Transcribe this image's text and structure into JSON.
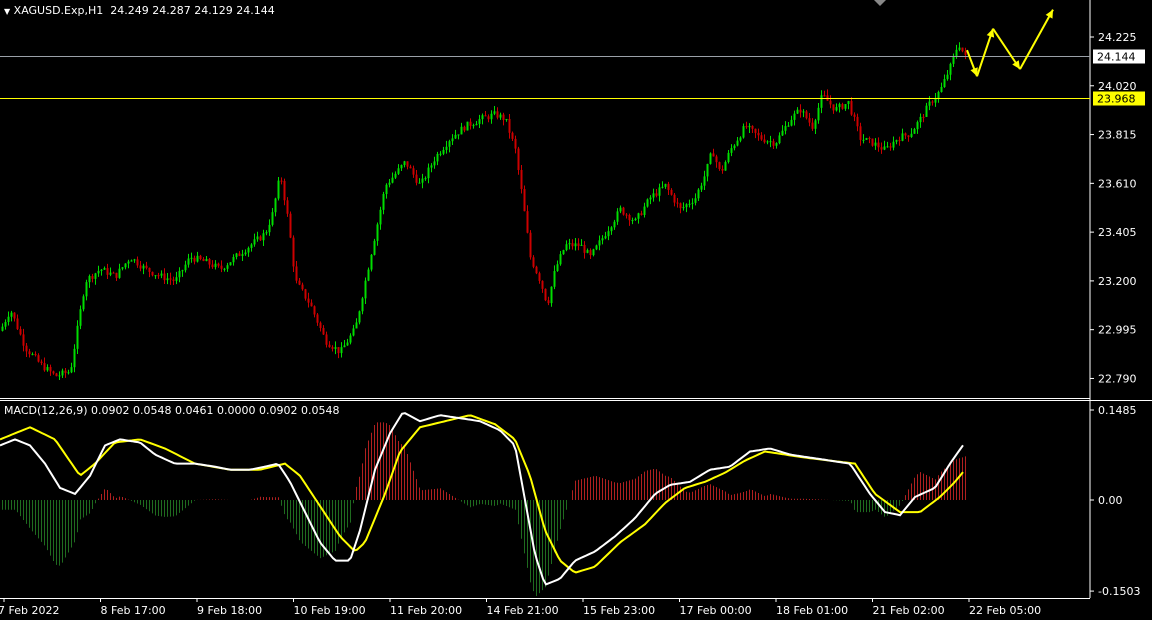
{
  "header": {
    "symbol": "XAGUSD.Exp,H1",
    "ohlc": "24.249 24.287 24.129 24.144",
    "macd_label": "MACD(12,26,9) 0.0902 0.0548 0.0461 0.0000 0.0902 0.0548"
  },
  "colors": {
    "background": "#000000",
    "grid": "#ffffff",
    "bull": "#00dd00",
    "bear": "#cc0000",
    "level": "#ffff00",
    "macd_line": "#ffffff",
    "signal_line": "#ffff00",
    "arrow": "#ffff00"
  },
  "chart_data": [
    {
      "type": "candlestick",
      "symbol": "XAGUSD.Exp",
      "timeframe": "H1",
      "y_ticks": [
        "24.225",
        "24.020",
        "23.815",
        "23.610",
        "23.405",
        "23.200",
        "22.995",
        "22.790"
      ],
      "ylim": [
        22.73,
        24.35
      ],
      "price_lines": [
        {
          "value": 24.144,
          "label": "24.144",
          "kind": "current"
        },
        {
          "value": 23.968,
          "label": "23.968",
          "kind": "level"
        }
      ],
      "x_labels": [
        "7 Feb 2022",
        "8 Feb 17:00",
        "9 Feb 18:00",
        "10 Feb 19:00",
        "11 Feb 20:00",
        "14 Feb 21:00",
        "15 Feb 23:00",
        "17 Feb 00:00",
        "18 Feb 01:00",
        "21 Feb 02:00",
        "22 Feb 05:00"
      ],
      "path_anchors": [
        [
          0,
          22.99
        ],
        [
          10,
          23.08
        ],
        [
          25,
          22.92
        ],
        [
          40,
          22.85
        ],
        [
          55,
          22.8
        ],
        [
          70,
          22.82
        ],
        [
          85,
          23.2
        ],
        [
          100,
          23.25
        ],
        [
          115,
          23.22
        ],
        [
          130,
          23.3
        ],
        [
          145,
          23.25
        ],
        [
          160,
          23.22
        ],
        [
          175,
          23.2
        ],
        [
          190,
          23.3
        ],
        [
          205,
          23.28
        ],
        [
          220,
          23.25
        ],
        [
          235,
          23.3
        ],
        [
          250,
          23.35
        ],
        [
          265,
          23.4
        ],
        [
          272,
          23.48
        ],
        [
          280,
          23.65
        ],
        [
          288,
          23.45
        ],
        [
          295,
          23.2
        ],
        [
          310,
          23.1
        ],
        [
          325,
          22.95
        ],
        [
          340,
          22.9
        ],
        [
          355,
          23.0
        ],
        [
          365,
          23.2
        ],
        [
          375,
          23.4
        ],
        [
          385,
          23.6
        ],
        [
          395,
          23.65
        ],
        [
          405,
          23.7
        ],
        [
          420,
          23.6
        ],
        [
          435,
          23.72
        ],
        [
          450,
          23.8
        ],
        [
          465,
          23.85
        ],
        [
          480,
          23.88
        ],
        [
          495,
          23.9
        ],
        [
          505,
          23.88
        ],
        [
          515,
          23.75
        ],
        [
          522,
          23.55
        ],
        [
          530,
          23.3
        ],
        [
          540,
          23.2
        ],
        [
          547,
          23.1
        ],
        [
          555,
          23.25
        ],
        [
          565,
          23.35
        ],
        [
          580,
          23.35
        ],
        [
          590,
          23.3
        ],
        [
          605,
          23.4
        ],
        [
          620,
          23.5
        ],
        [
          635,
          23.45
        ],
        [
          650,
          23.55
        ],
        [
          665,
          23.6
        ],
        [
          680,
          23.5
        ],
        [
          695,
          23.55
        ],
        [
          705,
          23.65
        ],
        [
          712,
          23.75
        ],
        [
          720,
          23.65
        ],
        [
          730,
          23.75
        ],
        [
          745,
          23.85
        ],
        [
          760,
          23.8
        ],
        [
          775,
          23.78
        ],
        [
          790,
          23.88
        ],
        [
          800,
          23.92
        ],
        [
          812,
          23.85
        ],
        [
          822,
          23.98
        ],
        [
          835,
          23.92
        ],
        [
          848,
          23.95
        ],
        [
          860,
          23.8
        ],
        [
          872,
          23.78
        ],
        [
          885,
          23.75
        ],
        [
          897,
          23.8
        ],
        [
          910,
          23.82
        ],
        [
          920,
          23.88
        ],
        [
          930,
          23.95
        ],
        [
          940,
          24.0
        ],
        [
          950,
          24.1
        ],
        [
          958,
          24.2
        ],
        [
          965,
          24.14
        ]
      ],
      "forecast_arrows": [
        {
          "from": [
            967,
            24.17
          ],
          "to": [
            977,
            24.06
          ]
        },
        {
          "from": [
            977,
            24.06
          ],
          "to": [
            993,
            24.26
          ]
        },
        {
          "from": [
            993,
            24.26
          ],
          "to": [
            1020,
            24.09
          ]
        },
        {
          "from": [
            1020,
            24.09
          ],
          "to": [
            1053,
            24.34
          ]
        }
      ]
    },
    {
      "type": "macd",
      "params": [
        12,
        26,
        9
      ],
      "values": [
        0.0902,
        0.0548,
        0.0461,
        0.0,
        0.0902,
        0.0548
      ],
      "y_ticks": [
        "0.1485",
        "0.00",
        "-0.1503"
      ],
      "ylim": [
        -0.1503,
        0.1485
      ],
      "macd_anchors": [
        [
          0,
          0.09
        ],
        [
          15,
          0.1
        ],
        [
          30,
          0.09
        ],
        [
          45,
          0.06
        ],
        [
          60,
          0.02
        ],
        [
          75,
          0.01
        ],
        [
          90,
          0.04
        ],
        [
          105,
          0.09
        ],
        [
          120,
          0.1
        ],
        [
          140,
          0.095
        ],
        [
          155,
          0.075
        ],
        [
          175,
          0.06
        ],
        [
          195,
          0.06
        ],
        [
          215,
          0.055
        ],
        [
          230,
          0.05
        ],
        [
          250,
          0.05
        ],
        [
          265,
          0.055
        ],
        [
          278,
          0.06
        ],
        [
          290,
          0.03
        ],
        [
          305,
          -0.02
        ],
        [
          320,
          -0.07
        ],
        [
          335,
          -0.1
        ],
        [
          350,
          -0.1
        ],
        [
          360,
          -0.05
        ],
        [
          375,
          0.05
        ],
        [
          390,
          0.11
        ],
        [
          403,
          0.145
        ],
        [
          420,
          0.13
        ],
        [
          440,
          0.14
        ],
        [
          460,
          0.135
        ],
        [
          480,
          0.13
        ],
        [
          500,
          0.115
        ],
        [
          515,
          0.09
        ],
        [
          525,
          0.0
        ],
        [
          535,
          -0.09
        ],
        [
          545,
          -0.14
        ],
        [
          560,
          -0.13
        ],
        [
          575,
          -0.1
        ],
        [
          595,
          -0.085
        ],
        [
          615,
          -0.06
        ],
        [
          635,
          -0.03
        ],
        [
          655,
          0.01
        ],
        [
          670,
          0.025
        ],
        [
          690,
          0.03
        ],
        [
          710,
          0.05
        ],
        [
          730,
          0.055
        ],
        [
          750,
          0.08
        ],
        [
          770,
          0.085
        ],
        [
          790,
          0.075
        ],
        [
          810,
          0.07
        ],
        [
          830,
          0.065
        ],
        [
          850,
          0.06
        ],
        [
          870,
          0.01
        ],
        [
          885,
          -0.02
        ],
        [
          900,
          -0.025
        ],
        [
          915,
          0.005
        ],
        [
          935,
          0.02
        ],
        [
          950,
          0.06
        ],
        [
          965,
          0.095
        ]
      ],
      "signal_anchors": [
        [
          0,
          0.1
        ],
        [
          30,
          0.12
        ],
        [
          55,
          0.1
        ],
        [
          80,
          0.04
        ],
        [
          95,
          0.06
        ],
        [
          115,
          0.095
        ],
        [
          140,
          0.1
        ],
        [
          165,
          0.085
        ],
        [
          195,
          0.06
        ],
        [
          230,
          0.05
        ],
        [
          260,
          0.05
        ],
        [
          285,
          0.06
        ],
        [
          300,
          0.04
        ],
        [
          320,
          -0.01
        ],
        [
          340,
          -0.06
        ],
        [
          355,
          -0.085
        ],
        [
          365,
          -0.07
        ],
        [
          385,
          0.01
        ],
        [
          400,
          0.08
        ],
        [
          420,
          0.12
        ],
        [
          445,
          0.13
        ],
        [
          470,
          0.14
        ],
        [
          495,
          0.125
        ],
        [
          515,
          0.1
        ],
        [
          530,
          0.04
        ],
        [
          545,
          -0.05
        ],
        [
          560,
          -0.1
        ],
        [
          575,
          -0.12
        ],
        [
          595,
          -0.11
        ],
        [
          620,
          -0.07
        ],
        [
          645,
          -0.04
        ],
        [
          665,
          -0.005
        ],
        [
          685,
          0.02
        ],
        [
          705,
          0.03
        ],
        [
          725,
          0.045
        ],
        [
          745,
          0.065
        ],
        [
          765,
          0.08
        ],
        [
          785,
          0.075
        ],
        [
          805,
          0.07
        ],
        [
          830,
          0.065
        ],
        [
          855,
          0.06
        ],
        [
          875,
          0.01
        ],
        [
          900,
          -0.02
        ],
        [
          920,
          -0.02
        ],
        [
          940,
          0.005
        ],
        [
          955,
          0.03
        ],
        [
          965,
          0.05
        ]
      ]
    }
  ]
}
